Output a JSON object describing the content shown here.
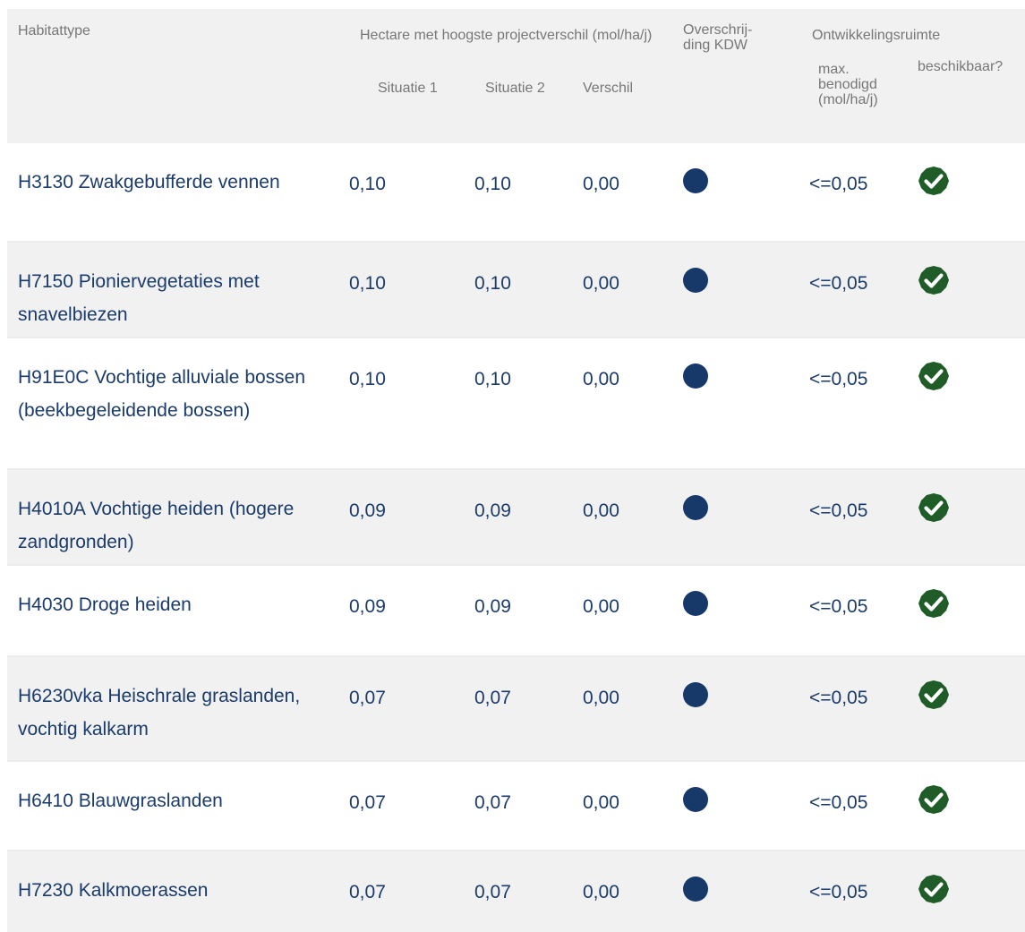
{
  "header": {
    "habitattype": "Habitattype",
    "hectare": "Hectare met hoogste projectverschil (mol/ha/j)",
    "situatie1": "Situatie 1",
    "situatie2": "Situatie 2",
    "verschil": "Verschil",
    "overschrijding": "Overschrij-\nding KDW",
    "ontwikkelingsruimte": "Ontwikkelingsruimte",
    "max_benodigd": "max. benodigd (mol/ha/j)",
    "beschikbaar": "beschikbaar?"
  },
  "rows": [
    {
      "name": "H3130 Zwakgebufferde vennen",
      "sit1": "0,10",
      "sit2": "0,10",
      "verschil": "0,00",
      "ontw": "<=0,05",
      "kdw_icon": "filled-circle-icon",
      "check_icon": "check-shield-icon"
    },
    {
      "name": "H7150 Pioniervegetaties met snavelbiezen",
      "sit1": "0,10",
      "sit2": "0,10",
      "verschil": "0,00",
      "ontw": "<=0,05",
      "kdw_icon": "filled-circle-icon",
      "check_icon": "check-shield-icon"
    },
    {
      "name": "H91E0C Vochtige alluviale bossen (beekbegeleidende bossen)",
      "sit1": "0,10",
      "sit2": "0,10",
      "verschil": "0,00",
      "ontw": "<=0,05",
      "kdw_icon": "filled-circle-icon",
      "check_icon": "check-shield-icon"
    },
    {
      "name": "H4010A Vochtige heiden (hogere zandgronden)",
      "sit1": "0,09",
      "sit2": "0,09",
      "verschil": "0,00",
      "ontw": "<=0,05",
      "kdw_icon": "filled-circle-icon",
      "check_icon": "check-shield-icon"
    },
    {
      "name": "H4030 Droge heiden",
      "sit1": "0,09",
      "sit2": "0,09",
      "verschil": "0,00",
      "ontw": "<=0,05",
      "kdw_icon": "filled-circle-icon",
      "check_icon": "check-shield-icon"
    },
    {
      "name": "H6230vka Heischrale graslanden, vochtig kalkarm",
      "sit1": "0,07",
      "sit2": "0,07",
      "verschil": "0,00",
      "ontw": "<=0,05",
      "kdw_icon": "filled-circle-icon",
      "check_icon": "check-shield-icon"
    },
    {
      "name": "H6410 Blauwgraslanden",
      "sit1": "0,07",
      "sit2": "0,07",
      "verschil": "0,00",
      "ontw": "<=0,05",
      "kdw_icon": "filled-circle-icon",
      "check_icon": "check-shield-icon"
    },
    {
      "name": "H7230 Kalkmoerassen",
      "sit1": "0,07",
      "sit2": "0,07",
      "verschil": "0,00",
      "ontw": "<=0,05",
      "kdw_icon": "filled-circle-icon",
      "check_icon": "check-shield-icon"
    }
  ],
  "colors": {
    "text": "#1a3b6b",
    "header_text": "#777777",
    "header_bg": "#f1f1f1",
    "alt_row_bg": "#f1f1f1",
    "kdw_dot": "#17396a",
    "check": "#1f5c27"
  }
}
